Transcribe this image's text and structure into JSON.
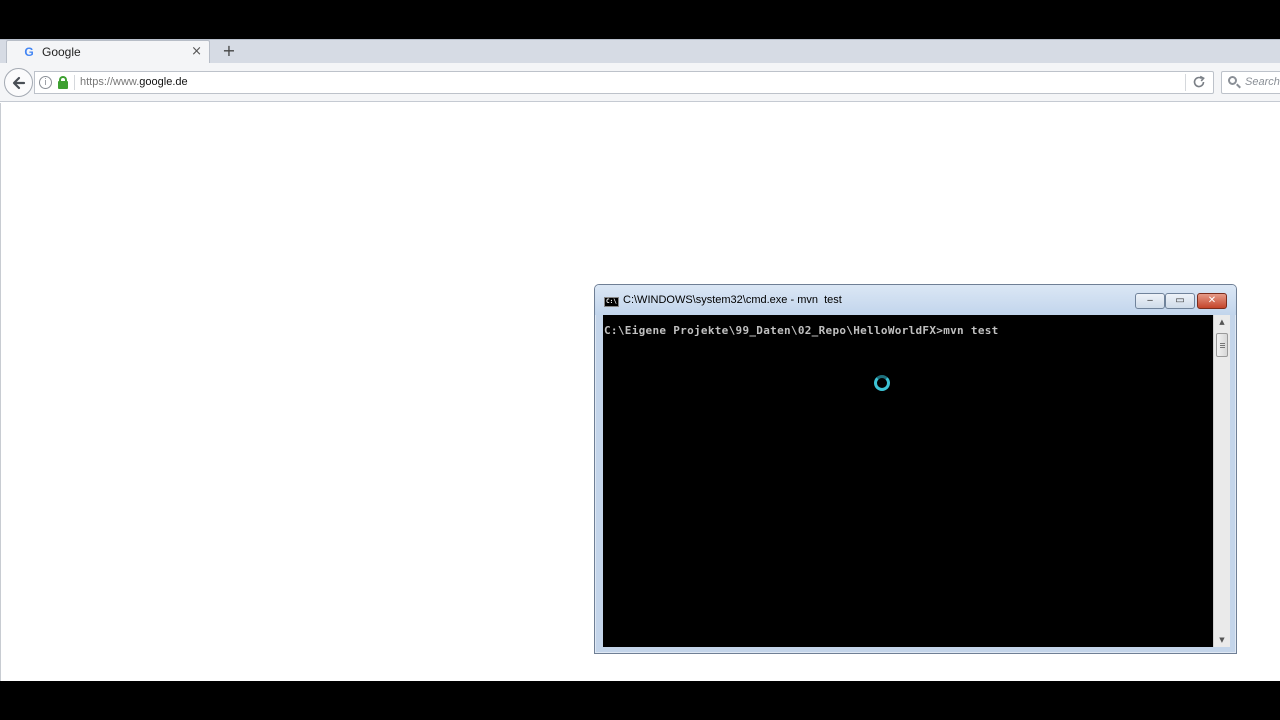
{
  "browser": {
    "tab": {
      "favicon": "G",
      "title": "Google",
      "close_icon": "×"
    },
    "new_tab_icon": "+",
    "url": {
      "prefix": "https://www.",
      "host": "google.de"
    },
    "search": {
      "placeholder": "Search"
    },
    "icons": [
      "back-arrow-icon",
      "info-icon",
      "lock-icon",
      "reload-icon",
      "search-icon"
    ]
  },
  "console": {
    "title": "C:\\WINDOWS\\system32\\cmd.exe - mvn  test",
    "icon_text": "C:\\",
    "lines": [
      "C:\\Eigene Projekte\\99_Daten\\02_Repo\\HelloWorldFX>mvn test"
    ],
    "controls": {
      "minimize": "‒",
      "maximize": "▭",
      "close": "✕"
    }
  },
  "colors": {
    "lock": "#3ea031",
    "console_text": "#c0c0c0",
    "spinner": "#3cc3d5",
    "close_button": "#c4452b"
  }
}
